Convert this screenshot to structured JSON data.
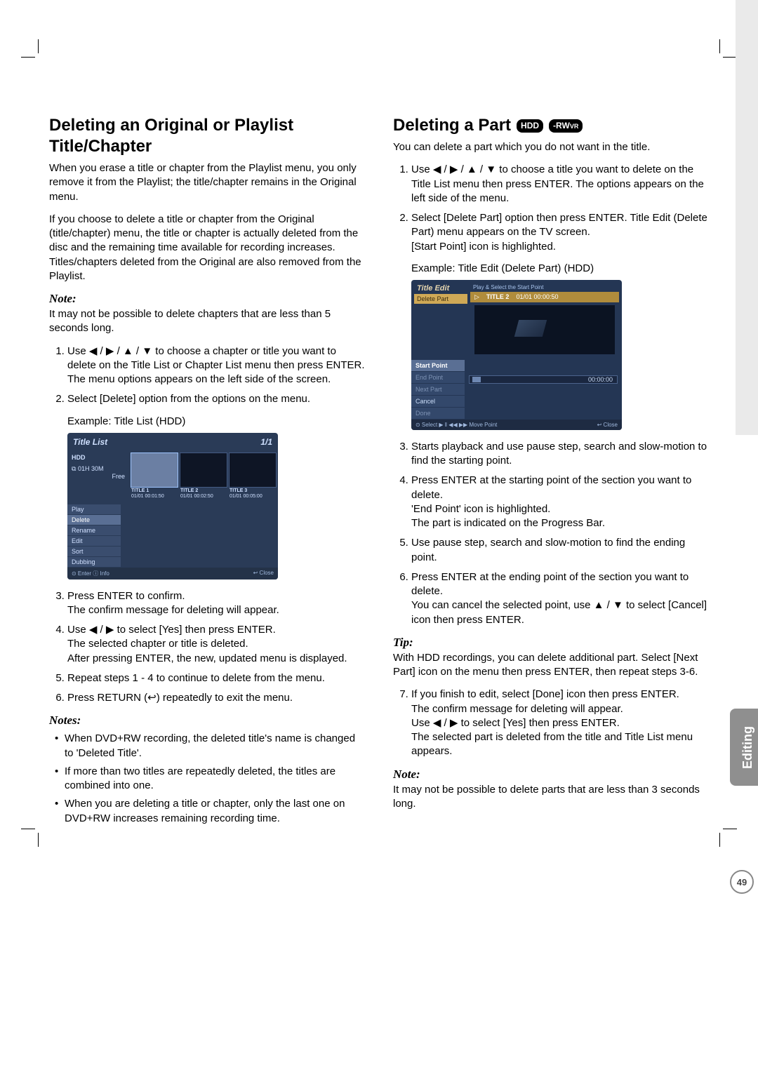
{
  "sideTab": {
    "label": "Editing",
    "pageNumber": "49"
  },
  "left": {
    "heading": "Deleting an Original or Playlist Title/Chapter",
    "p1": "When you erase a title or chapter from the Playlist menu, you only remove it from the Playlist; the title/chapter remains in the Original menu.",
    "p2": "If you choose to delete a title or chapter from the Original (title/chapter) menu, the title or chapter is actually deleted from the disc and the remaining time available for recording increases. Titles/chapters deleted from the Original are also removed from the Playlist.",
    "noteHeading": "Note:",
    "noteBody": "It may not be possible to delete chapters that are less than 5 seconds long.",
    "steps": [
      "Use ◀ / ▶ / ▲ / ▼ to choose a chapter or title you want to delete on the Title List or Chapter List menu then press ENTER.\nThe menu options appears on the left side of the screen.",
      "Select [Delete] option from the options on the menu."
    ],
    "example1": "Example: Title List (HDD)",
    "steps2": [
      "Press ENTER to confirm.\nThe confirm message for deleting will appear.",
      "Use ◀ / ▶ to select [Yes] then press ENTER.\nThe selected chapter or title is deleted.\nAfter pressing ENTER, the new, updated menu is displayed.",
      "Repeat steps 1 - 4 to continue to delete from the menu.",
      "Press RETURN (↩) repeatedly to exit the menu."
    ],
    "notesHeading": "Notes:",
    "notes": [
      "When DVD+RW recording, the deleted title's name is changed to 'Deleted Title'.",
      "If more than two titles are repeatedly deleted, the titles are combined into one.",
      "When you are deleting a title or chapter, only the last one on DVD+RW increases remaining recording time."
    ],
    "figTitleList": {
      "header": "Title List",
      "page": "1/1",
      "hdd": "HDD",
      "info1": "01H 30M",
      "info2": "Free",
      "thumbs": [
        {
          "t": "TITLE 1",
          "d": "01/01   00:01:50"
        },
        {
          "t": "TITLE 2",
          "d": "01/01   00:02:50"
        },
        {
          "t": "TITLE 3",
          "d": "01/01   00:05:00"
        }
      ],
      "menu": [
        "Play",
        "Delete",
        "Rename",
        "Edit",
        "Sort",
        "Dubbing"
      ],
      "footL": "⊙ Enter   ⓘ Info",
      "footR": "↩ Close"
    }
  },
  "right": {
    "heading": "Deleting a Part",
    "badges": {
      "hdd": "HDD",
      "rwvr": "-RWVR"
    },
    "p1": "You can delete a part which you do not want in the title.",
    "steps": [
      "Use ◀ / ▶ / ▲ / ▼ to choose a title you want to delete on the Title List menu then press ENTER. The options appears on the left side of the menu.",
      "Select [Delete Part] option then press ENTER. Title Edit (Delete Part) menu appears on the TV screen.\n[Start Point] icon is highlighted."
    ],
    "example1": "Example: Title Edit (Delete Part) (HDD)",
    "steps2": [
      "Starts playback and use pause step, search and slow-motion to find the starting point.",
      "Press ENTER at the starting point of the section you want to delete.\n'End Point' icon is highlighted.\nThe part is indicated on the Progress Bar.",
      "Use pause step, search and slow-motion to find the ending point.",
      "Press ENTER at the ending point of the section you want to delete.\nYou can cancel the selected point, use ▲ / ▼ to select [Cancel] icon then press ENTER."
    ],
    "tipHeading": "Tip:",
    "tipBody": "With HDD recordings, you can delete additional part. Select [Next Part] icon on the menu then press ENTER, then repeat steps 3-6.",
    "step7": "If you finish to edit, select [Done] icon then press ENTER.\nThe confirm message for deleting will appear.\nUse ◀ / ▶ to select [Yes] then press ENTER.\nThe selected part is deleted from the title and Title List menu appears.",
    "noteHeading": "Note:",
    "noteBody": "It may not be possible to delete parts that are less than 3 seconds long.",
    "figTitleEdit": {
      "header": "Title Edit",
      "sub": "Delete Part",
      "hint": "Play & Select the Start Point",
      "titleRow": {
        "icon": "▷",
        "t": "TITLE 2",
        "d": "01/01   00:00:50"
      },
      "menu": [
        "Start Point",
        "End Point",
        "Next Part",
        "Cancel",
        "Done"
      ],
      "time": "00:00:00",
      "footL": "⊙ Select   ▶ ‖ ◀◀ ▶▶ Move Point",
      "footR": "↩ Close"
    }
  }
}
